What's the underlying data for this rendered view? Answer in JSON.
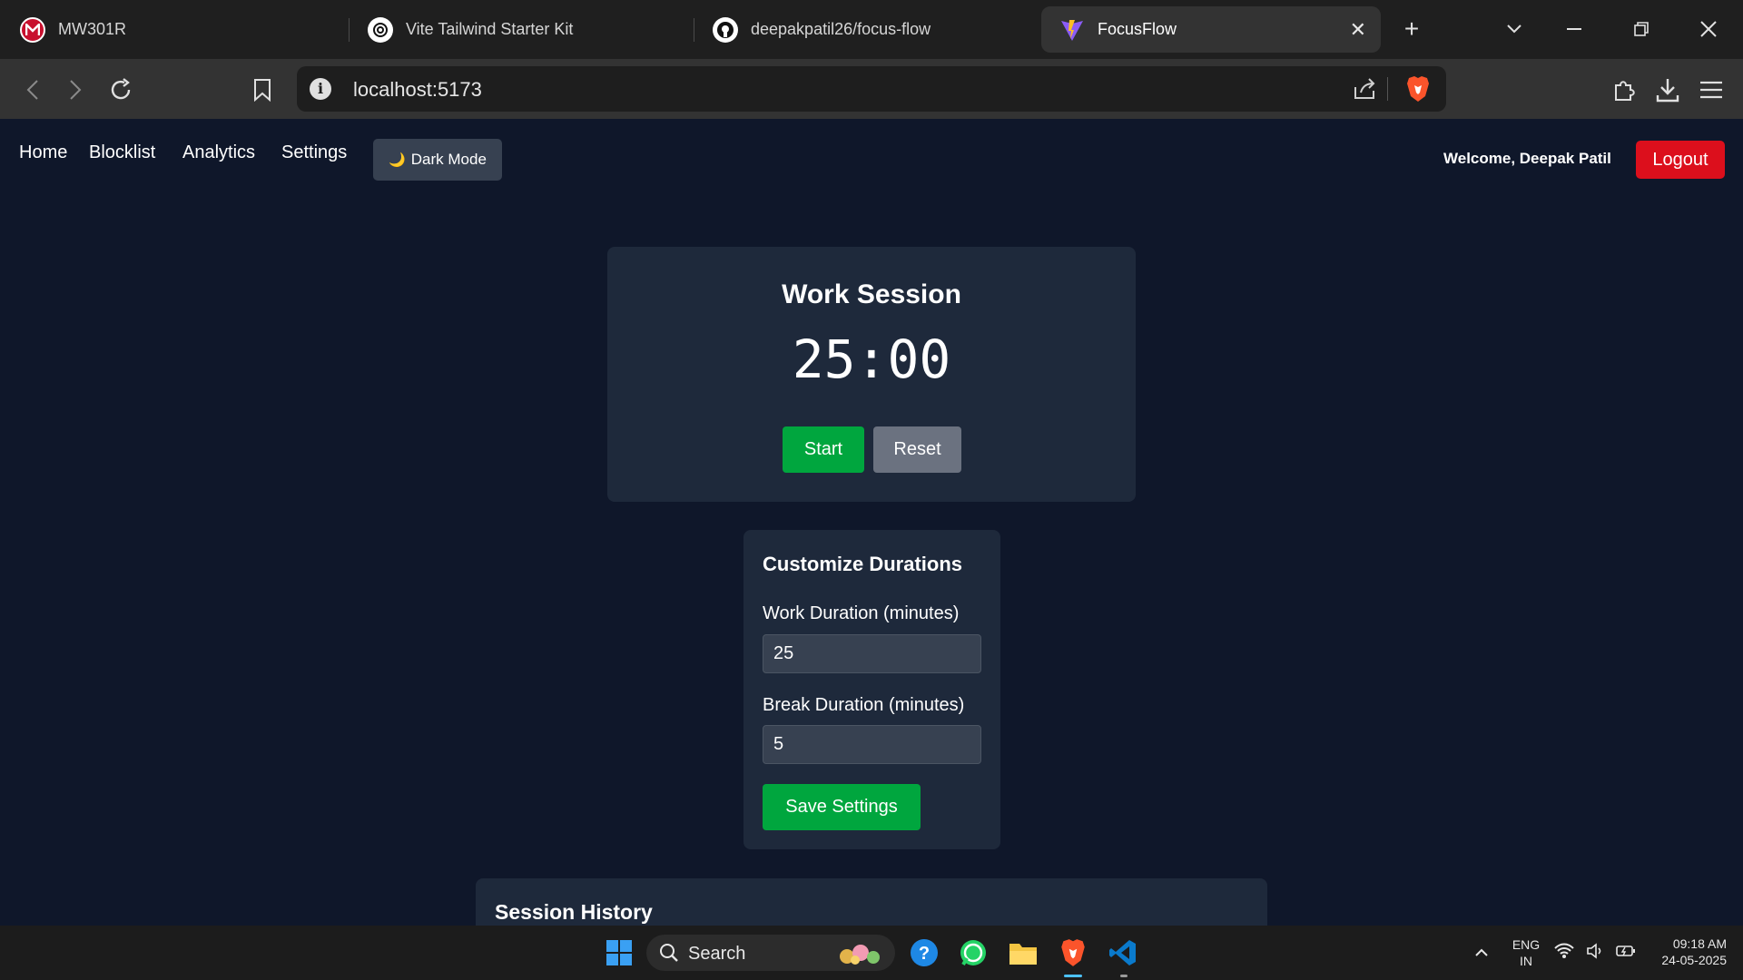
{
  "browser": {
    "tabs": [
      {
        "label": "MW301R",
        "icon": "mcafee-icon"
      },
      {
        "label": "Vite Tailwind Starter Kit",
        "icon": "chatgpt-icon"
      },
      {
        "label": "deepakpatil26/focus-flow",
        "icon": "github-icon"
      },
      {
        "label": "FocusFlow",
        "icon": "vite-icon",
        "active": true
      }
    ],
    "url": "localhost:5173"
  },
  "nav": {
    "links": [
      "Home",
      "Blocklist",
      "Analytics",
      "Settings"
    ],
    "dark_mode_label": "Dark Mode",
    "dark_mode_glyph": "🌙",
    "welcome": "Welcome, Deepak Patil",
    "logout": "Logout"
  },
  "session": {
    "title": "Work Session",
    "timer": "25:00",
    "start_label": "Start",
    "reset_label": "Reset"
  },
  "durations": {
    "title": "Customize Durations",
    "work_label": "Work Duration (minutes)",
    "work_value": "25",
    "break_label": "Break Duration (minutes)",
    "break_value": "5",
    "save_label": "Save Settings"
  },
  "history": {
    "title": "Session History"
  },
  "taskbar": {
    "search_label": "Search",
    "lang_top": "ENG",
    "lang_bottom": "IN",
    "time": "09:18 AM",
    "date": "24-05-2025"
  },
  "colors": {
    "page_bg": "#0f172a",
    "card_bg": "#1e293b",
    "primary_green": "#00a63e",
    "logout_red": "#dc0f1c"
  }
}
